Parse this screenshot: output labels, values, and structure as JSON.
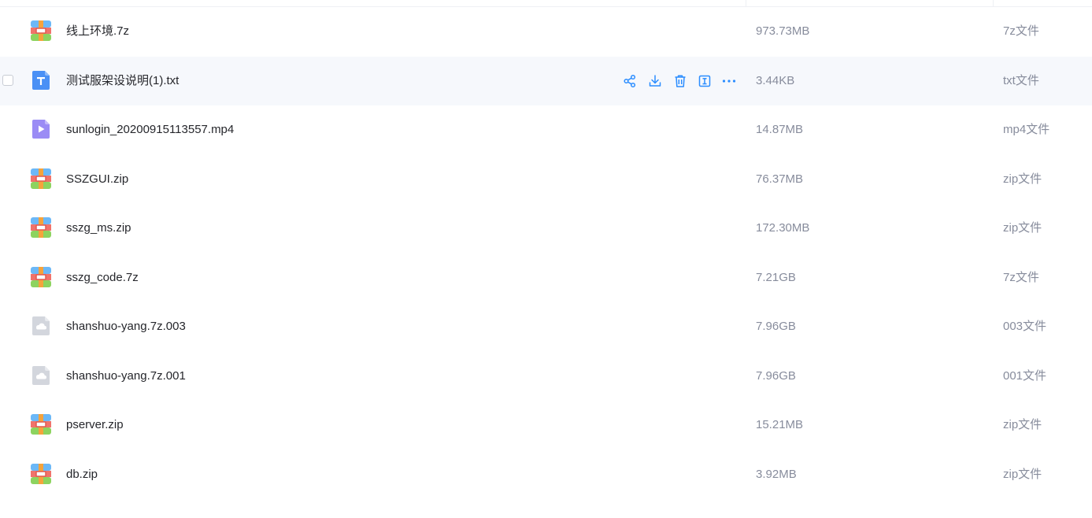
{
  "colors": {
    "accent": "#2b8dff",
    "row_hover": "#f6f8fc",
    "archive_top": "#6cb8f7",
    "archive_mid": "#f0736b",
    "archive_bottom": "#8dd35f",
    "archive_band": "#f5a33c",
    "text_icon": "#4a90f5",
    "video_icon": "#9b8cf5",
    "unknown_icon": "#d3d6dd"
  },
  "files": [
    {
      "name": "线上环境.7z",
      "size": "973.73MB",
      "type": "7z文件",
      "icon": "archive-icon"
    },
    {
      "name": "测试服架设说明(1).txt",
      "size": "3.44KB",
      "type": "txt文件",
      "icon": "text-file-icon"
    },
    {
      "name": "sunlogin_20200915113557.mp4",
      "size": "14.87MB",
      "type": "mp4文件",
      "icon": "video-file-icon"
    },
    {
      "name": "SSZGUI.zip",
      "size": "76.37MB",
      "type": "zip文件",
      "icon": "archive-icon"
    },
    {
      "name": "sszg_ms.zip",
      "size": "172.30MB",
      "type": "zip文件",
      "icon": "archive-icon"
    },
    {
      "name": "sszg_code.7z",
      "size": "7.21GB",
      "type": "7z文件",
      "icon": "archive-icon"
    },
    {
      "name": "shanshuo-yang.7z.003",
      "size": "7.96GB",
      "type": "003文件",
      "icon": "unknown-file-icon"
    },
    {
      "name": "shanshuo-yang.7z.001",
      "size": "7.96GB",
      "type": "001文件",
      "icon": "unknown-file-icon"
    },
    {
      "name": "pserver.zip",
      "size": "15.21MB",
      "type": "zip文件",
      "icon": "archive-icon"
    },
    {
      "name": "db.zip",
      "size": "3.92MB",
      "type": "zip文件",
      "icon": "archive-icon"
    }
  ],
  "row_actions": [
    "share-icon",
    "download-icon",
    "delete-icon",
    "rename-icon",
    "more-icon"
  ]
}
